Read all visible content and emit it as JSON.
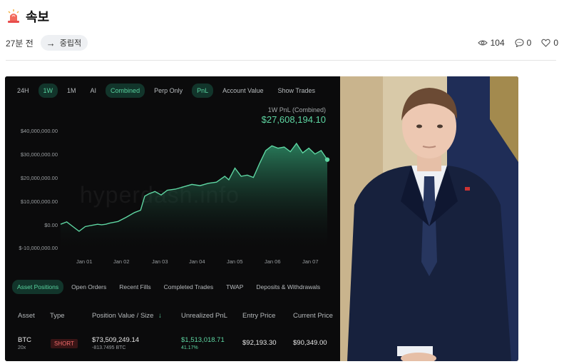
{
  "post": {
    "title": "속보",
    "time_ago": "27분 전",
    "tag_label": "중립적",
    "views": "104",
    "comments": "0",
    "likes": "0"
  },
  "dashboard": {
    "time_tabs": [
      "24H",
      "1W",
      "1M",
      "AI",
      "Combined",
      "Perp Only",
      "PnL",
      "Account Value",
      "Show Trades"
    ],
    "active_time_tabs": [
      "1W",
      "Combined",
      "PnL"
    ],
    "pnl_label": "1W PnL (Combined)",
    "pnl_value": "$27,608,194.10",
    "watermark": "hyperdash.info",
    "position_tabs": [
      "Asset Positions",
      "Open Orders",
      "Recent Fills",
      "Completed Trades",
      "TWAP",
      "Deposits & Withdrawals"
    ],
    "table_headers": [
      "Asset",
      "Type",
      "Position Value / Size",
      "Unrealized PnL",
      "Entry Price",
      "Current Price"
    ],
    "row": {
      "asset": "BTC",
      "leverage": "20x",
      "type": "SHORT",
      "position_value": "$73,509,249.14",
      "size": "-813.7495 BTC",
      "unrealized_pnl": "$1,513,018.71",
      "pnl_pct": "41.17%",
      "entry_price": "$92,193.30",
      "current_price": "$90,349.00"
    }
  },
  "chart_data": {
    "type": "area",
    "title": "1W PnL (Combined)",
    "x_ticks": [
      "Jan 01",
      "Jan 02",
      "Jan 03",
      "Jan 04",
      "Jan 05",
      "Jan 06",
      "Jan 07"
    ],
    "y_ticks": [
      "$40,000,000.00",
      "$30,000,000.00",
      "$20,000,000.00",
      "$10,000,000.00",
      "$0.00",
      "$-10,000,000.00"
    ],
    "ylim": [
      -10000000,
      40000000
    ],
    "series": [
      {
        "x": [
          0,
          0.15,
          0.3,
          0.45,
          0.6,
          0.75,
          0.9,
          1.0,
          1.1,
          1.2,
          1.4,
          1.6,
          1.8,
          1.95,
          2.05,
          2.15,
          2.3,
          2.45,
          2.6,
          2.8,
          3.0,
          3.2,
          3.4,
          3.6,
          3.8,
          4.0,
          4.1,
          4.25,
          4.4,
          4.55,
          4.7,
          4.85,
          5.0,
          5.15,
          5.3,
          5.45,
          5.6,
          5.75,
          5.9,
          6.05,
          6.2,
          6.35,
          6.5
        ],
        "values": [
          0,
          1000000,
          -1000000,
          -3000000,
          -1000000,
          -500000,
          0,
          -200000,
          0,
          500000,
          1200000,
          3000000,
          5000000,
          6000000,
          12000000,
          13000000,
          14000000,
          12500000,
          14500000,
          15000000,
          16000000,
          17000000,
          16500000,
          17500000,
          18000000,
          20500000,
          19000000,
          24000000,
          20500000,
          21000000,
          20000000,
          26000000,
          31500000,
          33500000,
          32500000,
          33000000,
          31000000,
          34500000,
          30500000,
          32500000,
          30000000,
          31500000,
          27608194
        ]
      }
    ]
  }
}
